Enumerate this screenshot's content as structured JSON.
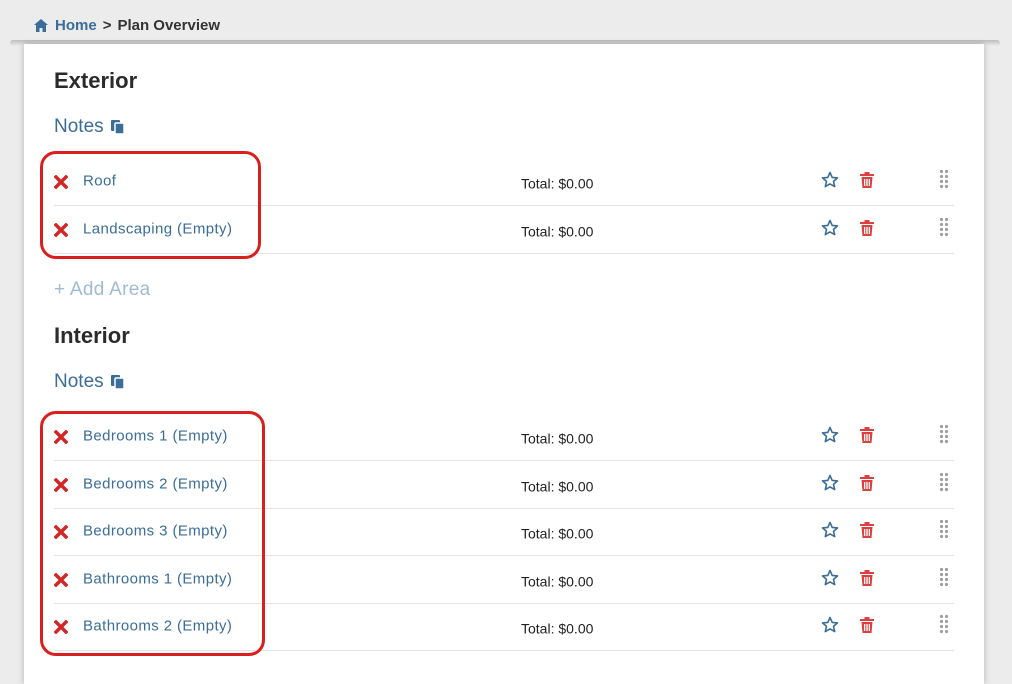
{
  "breadcrumb": {
    "home_icon": "home-icon",
    "home": "Home",
    "separator": ">",
    "current": "Plan Overview"
  },
  "sections": [
    {
      "title": "Exterior",
      "notes_label": "Notes",
      "notes_icon": "copy-icon",
      "areas": [
        {
          "name": "Roof",
          "total": "Total: $0.00"
        },
        {
          "name": "Landscaping (Empty)",
          "total": "Total: $0.00"
        }
      ],
      "add_label": "+ Add Area"
    },
    {
      "title": "Interior",
      "notes_label": "Notes",
      "notes_icon": "copy-icon",
      "areas": [
        {
          "name": "Bedrooms 1 (Empty)",
          "total": "Total: $0.00"
        },
        {
          "name": "Bedrooms 2 (Empty)",
          "total": "Total: $0.00"
        },
        {
          "name": "Bedrooms 3 (Empty)",
          "total": "Total: $0.00"
        },
        {
          "name": "Bathrooms 1 (Empty)",
          "total": "Total: $0.00"
        },
        {
          "name": "Bathrooms 2 (Empty)",
          "total": "Total: $0.00"
        }
      ]
    }
  ],
  "colors": {
    "link": "#3a6d98",
    "remove": "#d22727",
    "trash": "#d9403f",
    "highlight": "#d9201e",
    "add_area": "#9fbbd4"
  }
}
